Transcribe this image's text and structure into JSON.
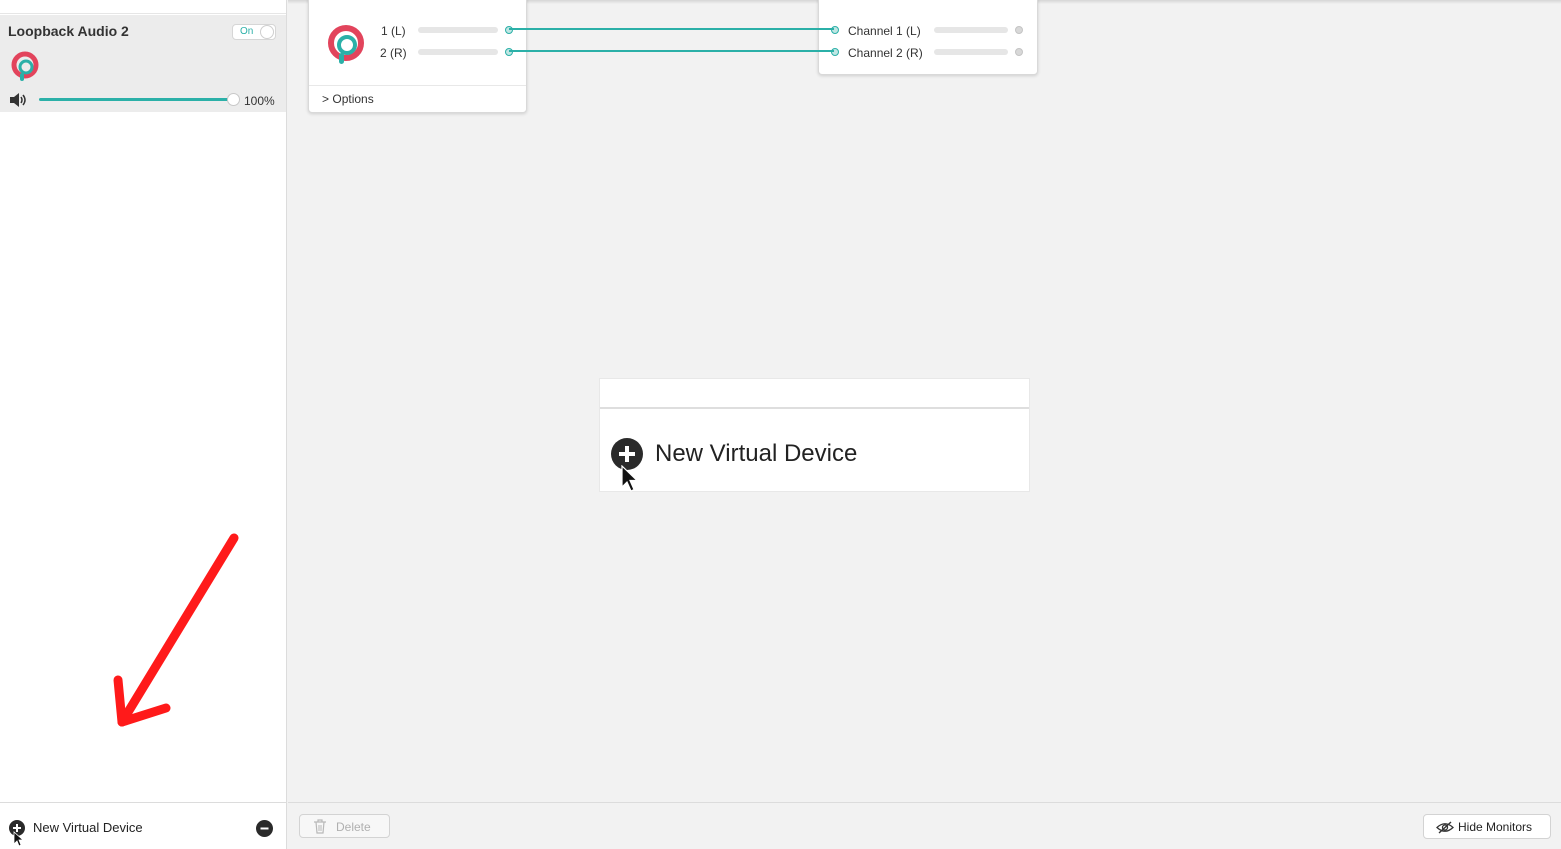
{
  "sidebar": {
    "device": {
      "name": "Loopback Audio 2",
      "toggle_label": "On",
      "volume_percent": "100%",
      "volume_level": 1.0
    },
    "footer": {
      "add_label": "New Virtual Device"
    }
  },
  "main": {
    "source": {
      "channels": [
        "1 (L)",
        "2 (R)"
      ],
      "options_label": "Options",
      "options_chevron": ">"
    },
    "output": {
      "channels": [
        "Channel 1 (L)",
        "Channel 2 (R)"
      ]
    },
    "callout": {
      "label": "New Virtual Device"
    }
  },
  "toolbar": {
    "delete_label": "Delete",
    "hide_monitors_label": "Hide Monitors"
  },
  "colors": {
    "accent": "#2bb0a8",
    "brand_red": "#e2445c",
    "annotation": "#ff1a1a"
  },
  "icons": [
    "loopback-logo-icon",
    "speaker-icon",
    "add-circle-icon",
    "remove-circle-icon",
    "trash-icon",
    "eye-slash-icon",
    "cursor-icon",
    "arrow-annotation"
  ]
}
